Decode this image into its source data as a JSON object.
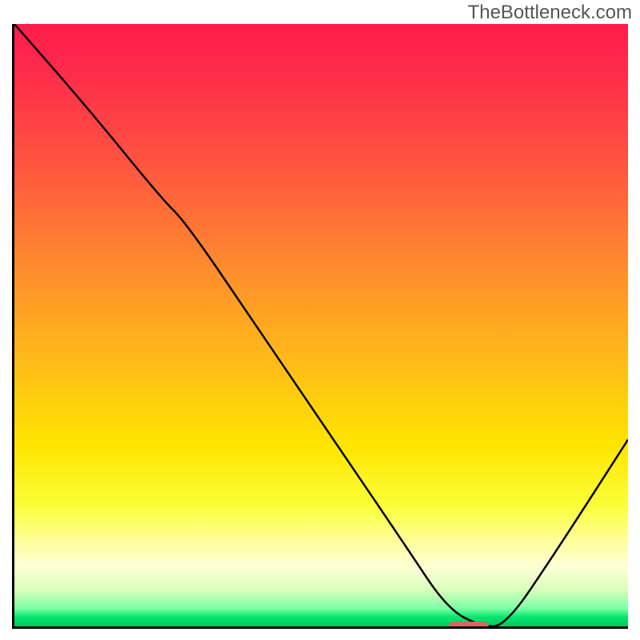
{
  "attribution": "TheBottleneck.com",
  "chart_data": {
    "type": "line",
    "title": "",
    "xlabel": "",
    "ylabel": "",
    "xlim": [
      0,
      100
    ],
    "ylim": [
      0,
      100
    ],
    "series": [
      {
        "name": "curve",
        "x": [
          0,
          12,
          24,
          28,
          40,
          52,
          64,
          70.5,
          76,
          80,
          88,
          100
        ],
        "y": [
          100,
          86,
          71,
          67,
          49,
          31,
          13,
          3,
          0,
          0,
          12,
          31
        ]
      }
    ],
    "marker": {
      "x_start": 70.5,
      "x_end": 77,
      "y": 0.3
    },
    "gradient_stops": [
      {
        "pos": 0,
        "color": "#ff1c4b"
      },
      {
        "pos": 0.55,
        "color": "#ffb81a"
      },
      {
        "pos": 0.8,
        "color": "#fbff3a"
      },
      {
        "pos": 0.985,
        "color": "#00e66d"
      },
      {
        "pos": 1.0,
        "color": "#00c85c"
      }
    ]
  }
}
